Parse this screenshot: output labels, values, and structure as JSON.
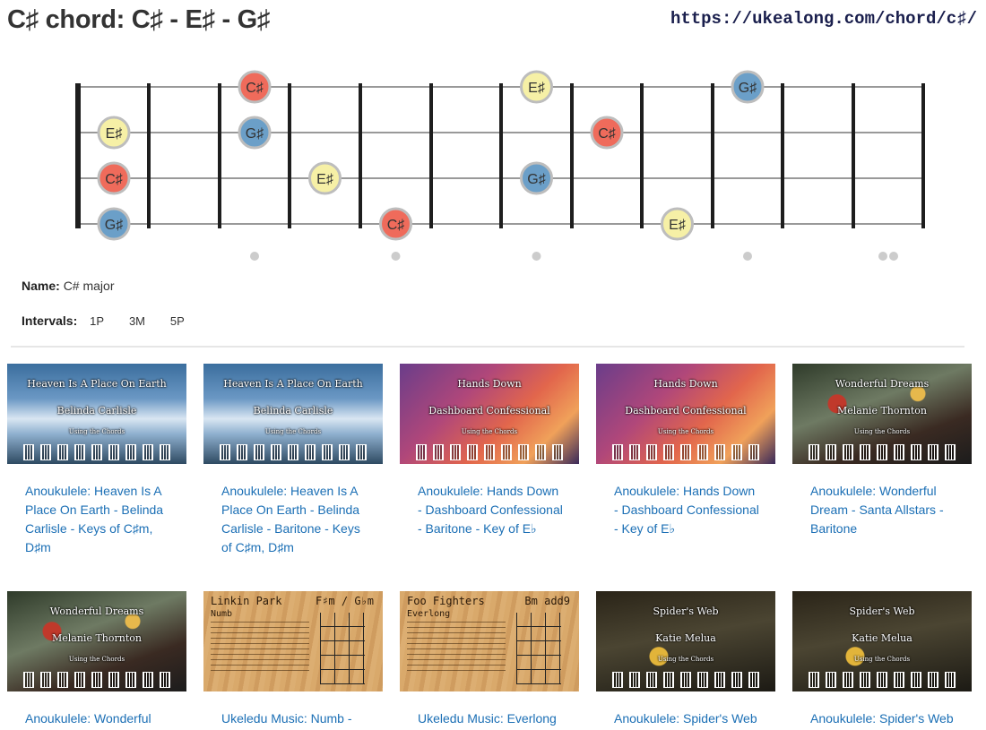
{
  "header": {
    "title": "C♯ chord: C♯ - E♯ - G♯",
    "url": "https://ukealong.com/chord/c♯/"
  },
  "fretboard": {
    "notes": [
      {
        "label": "C♯",
        "string": 1,
        "fret": 3,
        "color": "#ef6b5b"
      },
      {
        "label": "E♯",
        "string": 1,
        "fret": 7,
        "color": "#f6f0a6"
      },
      {
        "label": "G♯",
        "string": 1,
        "fret": 10,
        "color": "#6b9fc8"
      },
      {
        "label": "E♯",
        "string": 2,
        "fret": 0,
        "color": "#f6f0a6"
      },
      {
        "label": "G♯",
        "string": 2,
        "fret": 3,
        "color": "#6b9fc8"
      },
      {
        "label": "C♯",
        "string": 2,
        "fret": 8,
        "color": "#ef6b5b"
      },
      {
        "label": "C♯",
        "string": 3,
        "fret": 0,
        "color": "#ef6b5b"
      },
      {
        "label": "E♯",
        "string": 3,
        "fret": 4,
        "color": "#f6f0a6"
      },
      {
        "label": "G♯",
        "string": 3,
        "fret": 7,
        "color": "#6b9fc8"
      },
      {
        "label": "G♯",
        "string": 4,
        "fret": 0,
        "color": "#6b9fc8"
      },
      {
        "label": "C♯",
        "string": 4,
        "fret": 5,
        "color": "#ef6b5b"
      },
      {
        "label": "E♯",
        "string": 4,
        "fret": 9,
        "color": "#f6f0a6"
      }
    ],
    "markers": [
      3,
      5,
      7,
      10,
      12
    ]
  },
  "info": {
    "name_label": "Name:",
    "name_value": "C# major",
    "intervals_label": "Intervals:",
    "intervals": [
      "1P",
      "3M",
      "5P"
    ]
  },
  "cards": [
    {
      "thumb": {
        "line1": "Heaven Is A Place On Earth",
        "line2": "Belinda Carlisle",
        "line3": "Using the Chords",
        "theme": "sky"
      },
      "title": "Anoukulele: Heaven Is A Place On Earth - Belinda Carlisle - Keys of C♯m, D♯m"
    },
    {
      "thumb": {
        "line1": "Heaven Is A Place On Earth",
        "line2": "Belinda Carlisle",
        "line3": "Using the Chords",
        "theme": "sky"
      },
      "title": "Anoukulele: Heaven Is A Place On Earth - Belinda Carlisle - Baritone - Keys of C♯m, D♯m"
    },
    {
      "thumb": {
        "line1": "Hands Down",
        "line2": "Dashboard Confessional",
        "line3": "Using the Chords",
        "theme": "sunset"
      },
      "title": "Anoukulele: Hands Down - Dashboard Confessional - Baritone - Key of E♭"
    },
    {
      "thumb": {
        "line1": "Hands Down",
        "line2": "Dashboard Confessional",
        "line3": "Using the Chords",
        "theme": "sunset"
      },
      "title": "Anoukulele: Hands Down - Dashboard Confessional - Key of E♭"
    },
    {
      "thumb": {
        "line1": "Wonderful Dreams",
        "line2": "Melanie Thornton",
        "line3": "Using the Chords",
        "theme": "xmas"
      },
      "title": "Anoukulele: Wonderful Dream - Santa Allstars - Baritone"
    },
    {
      "thumb": {
        "line1": "Wonderful Dreams",
        "line2": "Melanie Thornton",
        "line3": "Using the Chords",
        "theme": "xmas"
      },
      "title": "Anoukulele: Wonderful"
    },
    {
      "thumb": {
        "band": "Linkin Park",
        "song": "Numb",
        "chord": "F♯m / G♭m",
        "theme": "wood"
      },
      "title": "Ukeledu Music: Numb -"
    },
    {
      "thumb": {
        "band": "Foo Fighters",
        "song": "Everlong",
        "chord": "Bm add9",
        "theme": "wood"
      },
      "title": "Ukeledu Music: Everlong"
    },
    {
      "thumb": {
        "line1": "Spider's Web",
        "line2": "Katie Melua",
        "line3": "Using the Chords",
        "theme": "dark"
      },
      "title": "Anoukulele: Spider's Web"
    },
    {
      "thumb": {
        "line1": "Spider's Web",
        "line2": "Katie Melua",
        "line3": "Using the Chords",
        "theme": "dark"
      },
      "title": "Anoukulele: Spider's Web"
    }
  ]
}
